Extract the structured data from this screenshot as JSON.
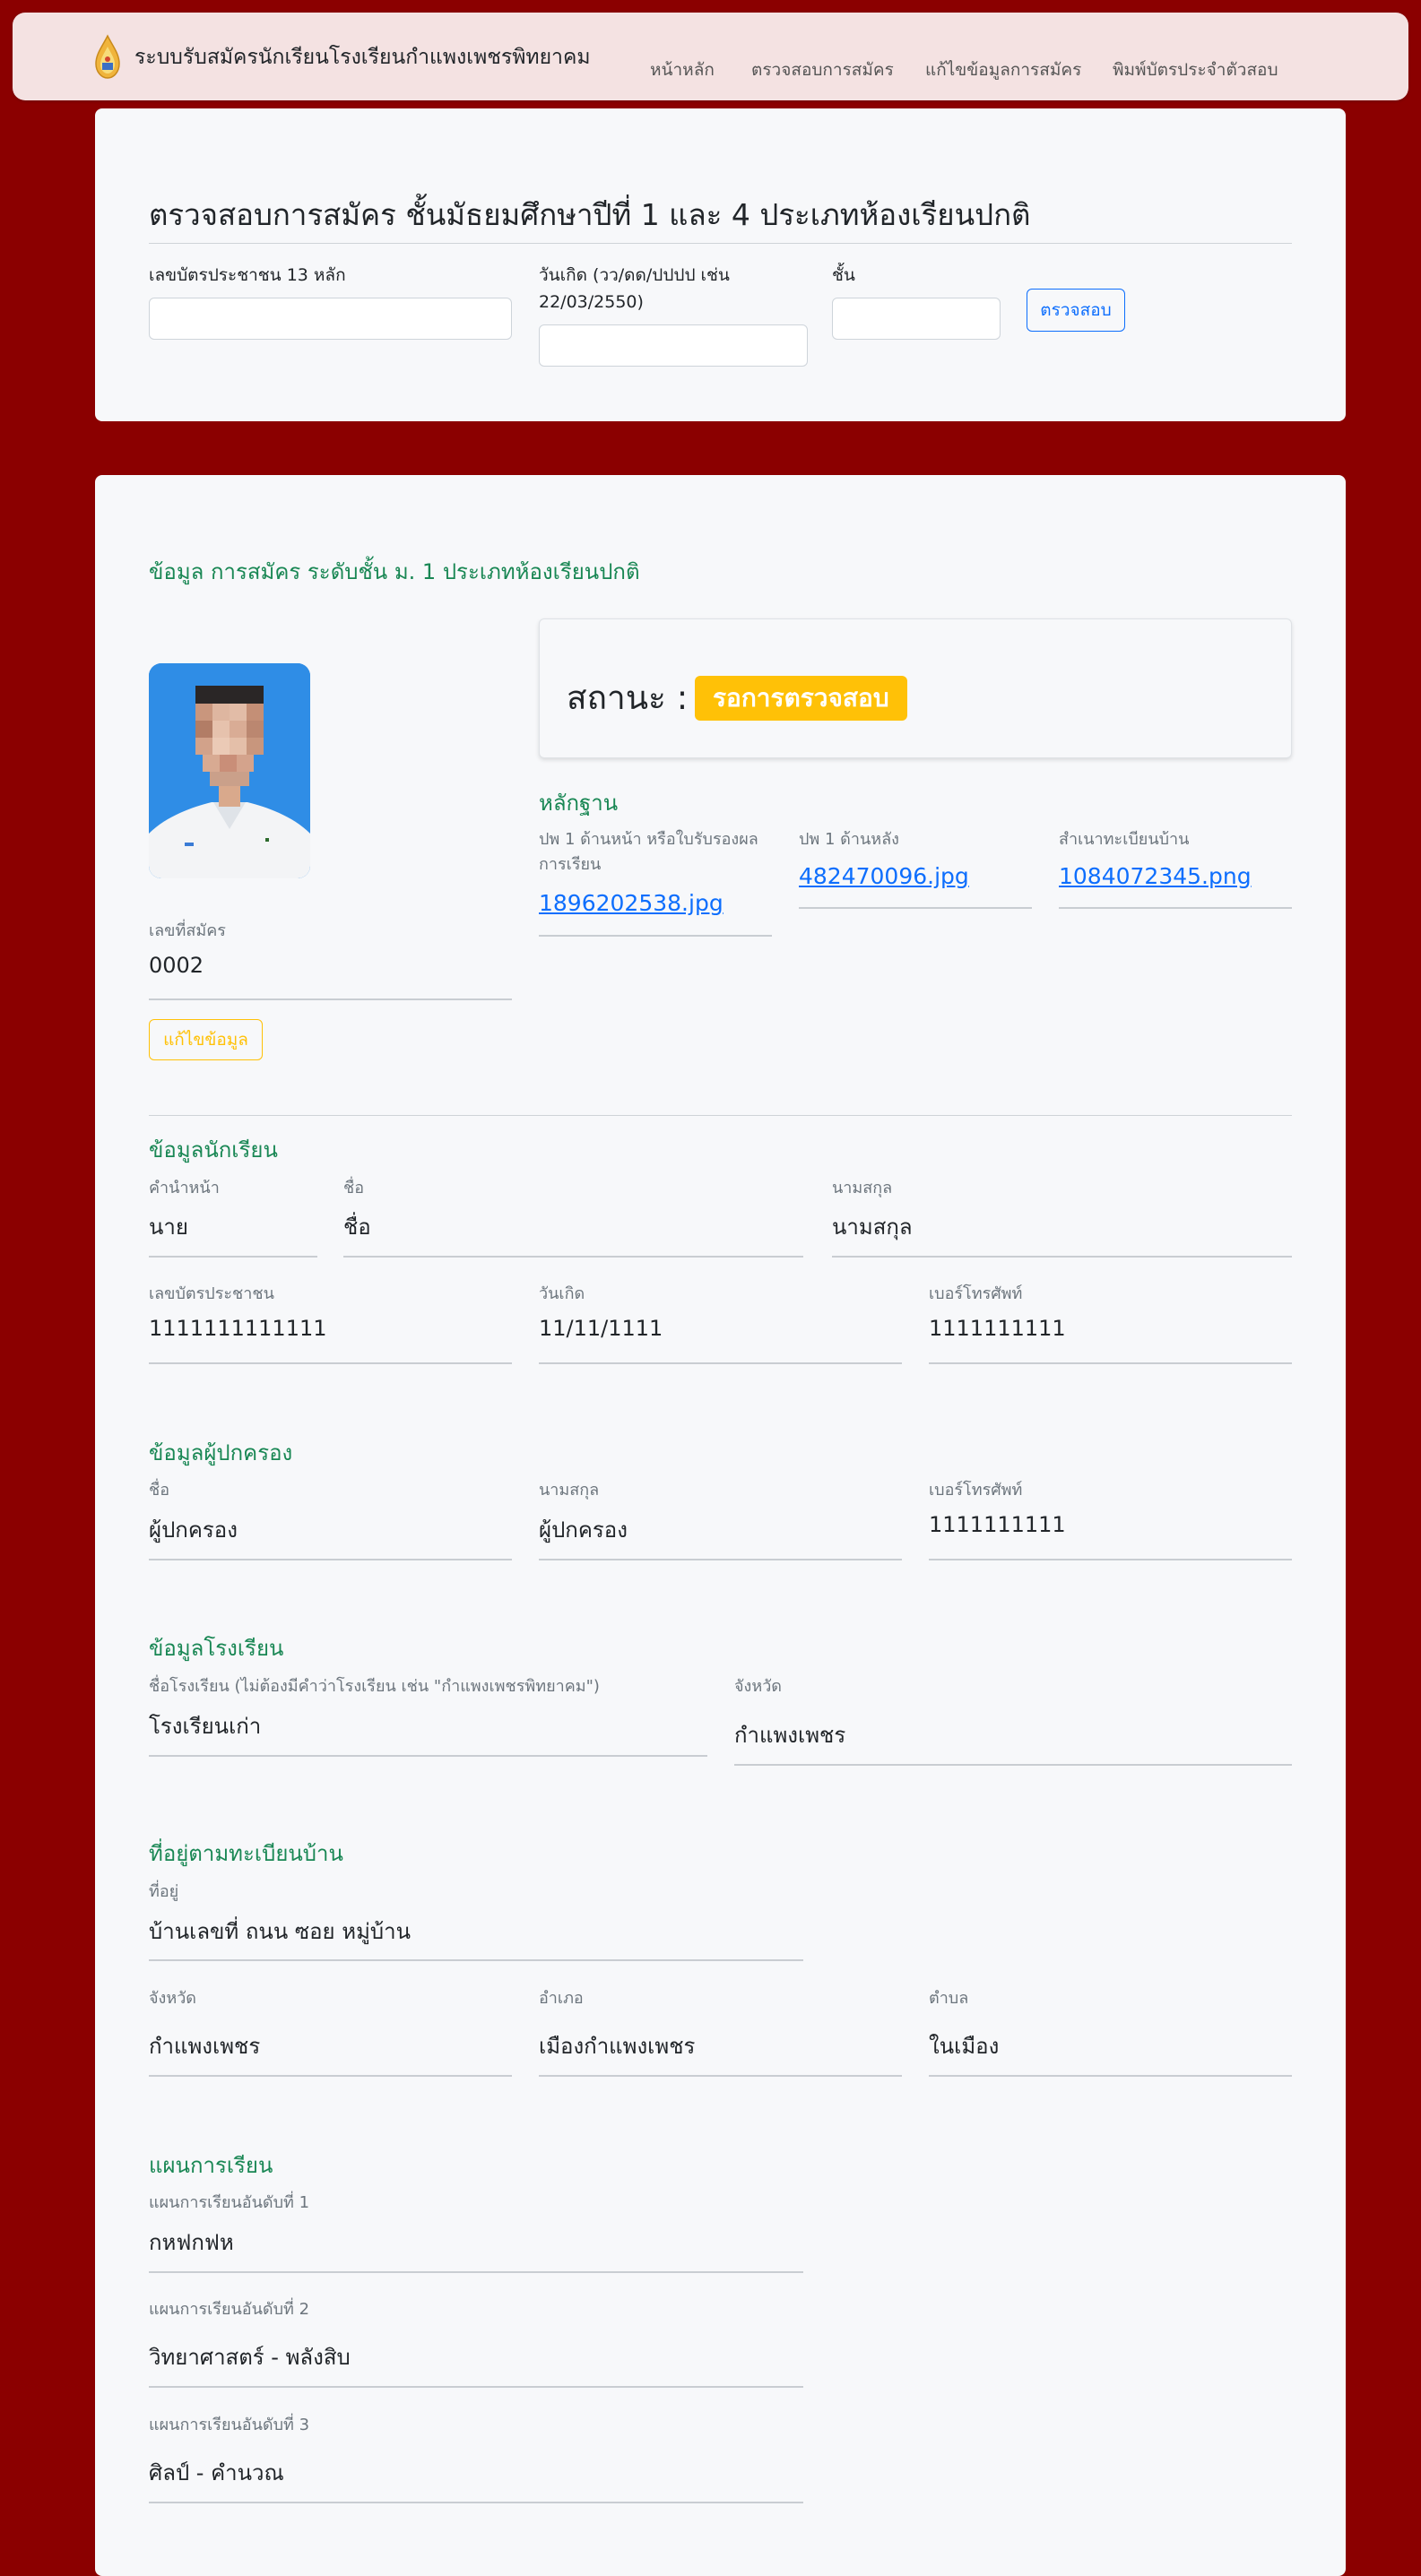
{
  "navbar": {
    "brand": "ระบบรับสมัครนักเรียนโรงเรียนกำแพงเพชรพิทยาคม",
    "links": [
      "หน้าหลัก",
      "ตรวจสอบการสมัคร",
      "แก้ไขข้อมูลการสมัคร",
      "พิมพ์บัตรประจำตัวสอบ"
    ]
  },
  "search": {
    "title": "ตรวจสอบการสมัคร ชั้นมัธยมศึกษาปีที่ 1 และ 4 ประเภทห้องเรียนปกติ",
    "id_label": "เลขบัตรประชาชน 13 หลัก",
    "id_value": "",
    "dob_label": "วันเกิด (วว/ดด/ปปปป เช่น 22/03/2550)",
    "dob_value": "",
    "grade_label": "ชั้น",
    "grade_value": "",
    "button": "ตรวจสอบ"
  },
  "application": {
    "title": "ข้อมูล การสมัคร ระดับชั้น ม. 1 ประเภทห้องเรียนปกติ",
    "status_label": "สถานะ :",
    "status_value": "รอการตรวจสอบ",
    "app_no_label": "เลขที่สมัคร",
    "app_no_value": "0002",
    "edit_button": "แก้ไขข้อมูล",
    "evidence": {
      "title": "หลักฐาน",
      "items": [
        {
          "label": "ปพ 1 ด้านหน้า หรือใบรับรองผลการเรียน",
          "file": "1896202538.jpg"
        },
        {
          "label": "ปพ 1 ด้านหลัง",
          "file": "482470096.jpg"
        },
        {
          "label": "สำเนาทะเบียนบ้าน",
          "file": "1084072345.png"
        }
      ]
    }
  },
  "student": {
    "title": "ข้อมูลนักเรียน",
    "prefix_label": "คำนำหน้า",
    "prefix": "นาย",
    "first_label": "ชื่อ",
    "first": "ชื่อ",
    "last_label": "นามสกุล",
    "last": "นามสกุล",
    "id_label": "เลขบัตรประชาชน",
    "id": "1111111111111",
    "dob_label": "วันเกิด",
    "dob": "11/11/1111",
    "phone_label": "เบอร์โทรศัพท์",
    "phone": "1111111111"
  },
  "guardian": {
    "title": "ข้อมูลผู้ปกครอง",
    "first_label": "ชื่อ",
    "first": "ผู้ปกครอง",
    "last_label": "นามสกุล",
    "last": "ผู้ปกครอง",
    "phone_label": "เบอร์โทรศัพท์",
    "phone": "1111111111"
  },
  "school": {
    "title": "ข้อมูลโรงเรียน",
    "name_label": "ชื่อโรงเรียน (ไม่ต้องมีคำว่าโรงเรียน เช่น \"กำแพงเพชรพิทยาคม\")",
    "name": "โรงเรียนเก่า",
    "province_label": "จังหวัด",
    "province": "กำแพงเพชร"
  },
  "address": {
    "title": "ที่อยู่ตามทะเบียนบ้าน",
    "addr_label": "ที่อยู่",
    "addr": "บ้านเลขที่ ถนน ซอย หมู่บ้าน",
    "province_label": "จังหวัด",
    "province": "กำแพงเพชร",
    "district_label": "อำเภอ",
    "district": "เมืองกำแพงเพชร",
    "subdistrict_label": "ตำบล",
    "subdistrict": "ในเมือง"
  },
  "plans": {
    "title": "แผนการเรียน",
    "items": [
      {
        "label": "แผนการเรียนอันดับที่ 1",
        "value": "กหฟกฟห"
      },
      {
        "label": "แผนการเรียนอันดับที่ 2",
        "value": "วิทยาศาสตร์ - พลังสิบ"
      },
      {
        "label": "แผนการเรียนอันดับที่ 3",
        "value": "ศิลป์ - คำนวณ"
      }
    ]
  },
  "colors": {
    "background": "#8b0000",
    "accent_green": "#198754",
    "link_blue": "#0d6efd",
    "status_yellow": "#ffc107"
  },
  "icons": {
    "brand_logo": "school-emblem-icon"
  }
}
